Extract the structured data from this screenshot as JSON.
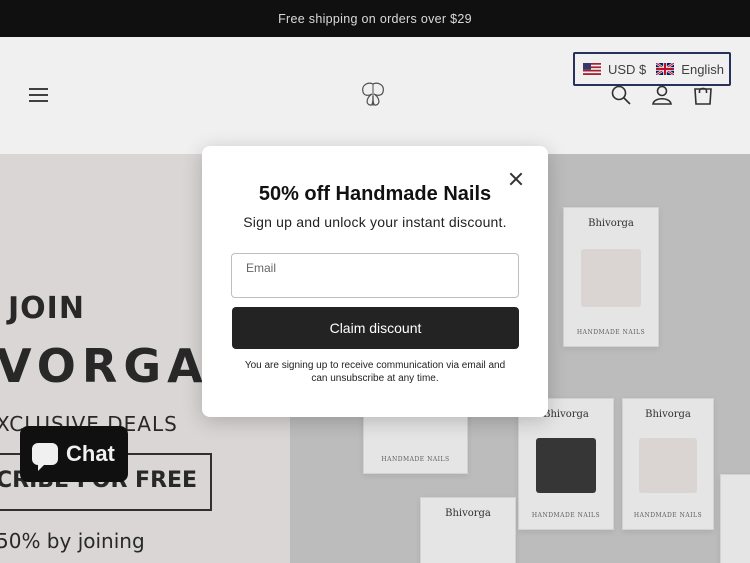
{
  "announcement": {
    "text": "Free shipping on orders over $29"
  },
  "header": {
    "currency": "USD $",
    "language": "English"
  },
  "hero": {
    "join": "JOIN",
    "brand": "VORGA",
    "deals": "XCLUSIVE  DEALS",
    "subscribe": "CRIBE FOR FREE",
    "joining": "50% by joining"
  },
  "products": {
    "brand": "Bhivorga",
    "caption": "HANDMADE NAILS"
  },
  "chat": {
    "label": "Chat"
  },
  "modal": {
    "title": "50% off Handmade Nails",
    "subtitle": "Sign up and unlock your instant discount.",
    "email_label": "Email",
    "email_value": "",
    "button": "Claim discount",
    "legal": "You are signing up to receive communication via email and can unsubscribe at any time."
  },
  "colors": {
    "announcement_bg": "#121212",
    "button_bg": "#232323",
    "locale_border": "#2a3560"
  }
}
